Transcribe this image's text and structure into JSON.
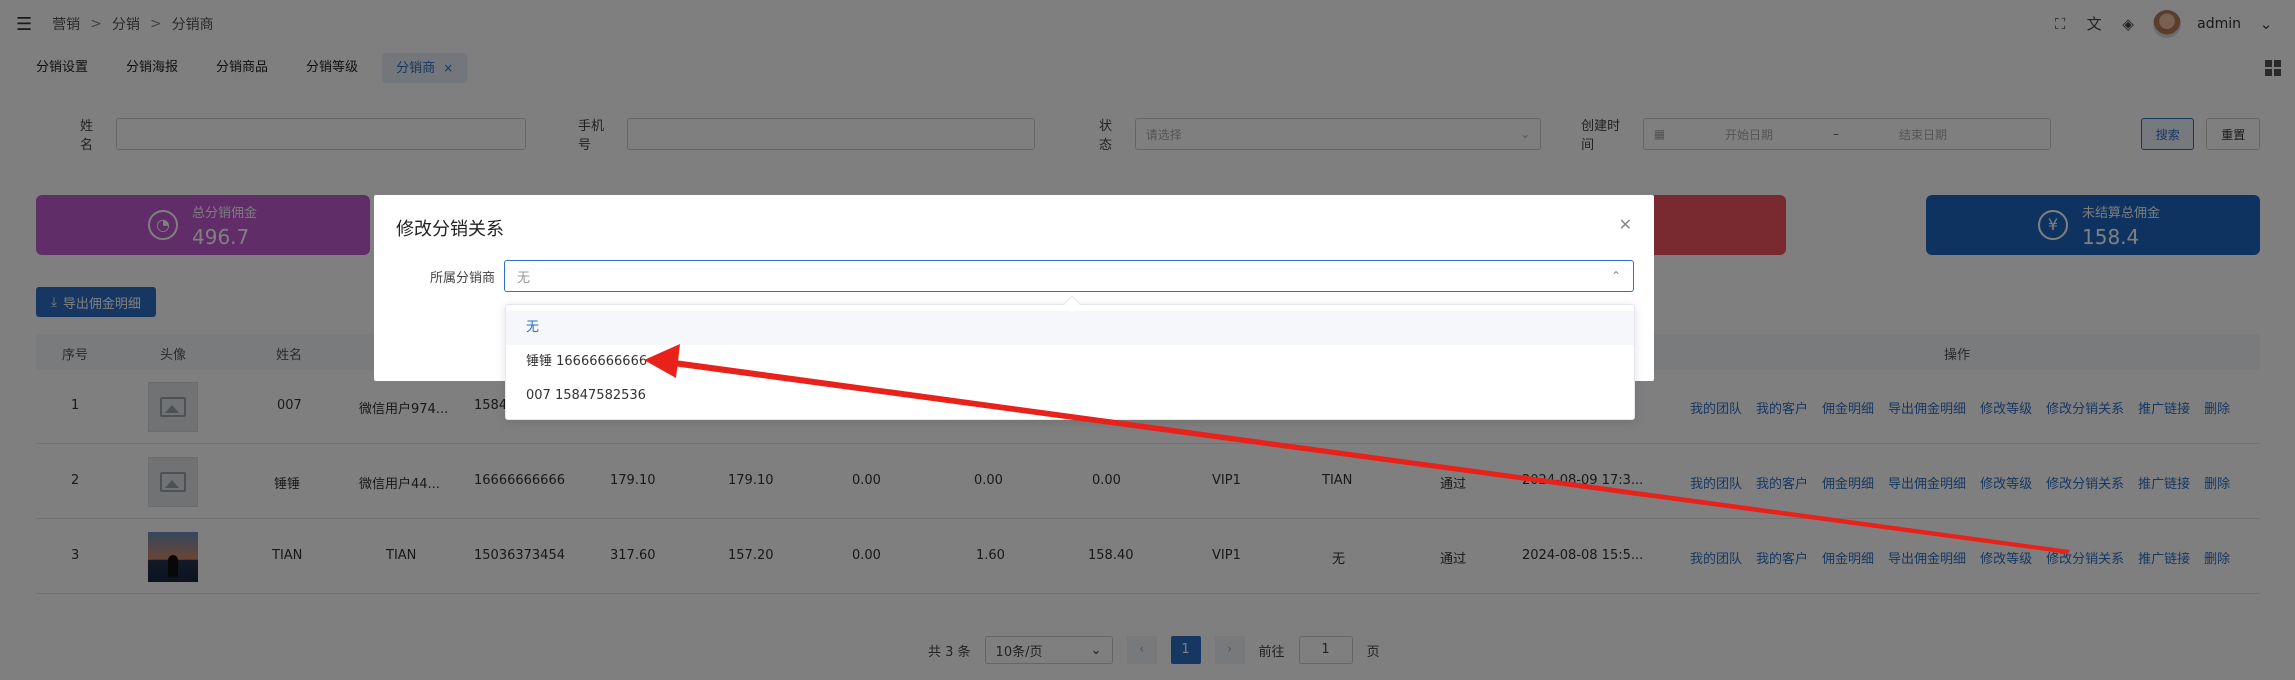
{
  "header": {
    "breadcrumb": [
      "营销",
      "分销",
      "分销商"
    ],
    "breadcrumb_sep": ">",
    "admin": "admin"
  },
  "tags": [
    "分销设置",
    "分销海报",
    "分销商品",
    "分销等级",
    "分销商"
  ],
  "search": {
    "name_label": "姓名",
    "phone_label": "手机号",
    "status_label": "状态",
    "status_placeholder": "请选择",
    "created_label": "创建时间",
    "start_placeholder": "开始日期",
    "range_sep": "–",
    "end_placeholder": "结束日期",
    "search_btn": "搜索",
    "reset_btn": "重置"
  },
  "cards": {
    "first": {
      "label": "总分销佣金",
      "value": "496.7",
      "color": "#8e2a99"
    },
    "last": {
      "label": "未结算总佣金",
      "value": "158.4",
      "color": "#0f3a6f"
    }
  },
  "export_btn": "导出佣金明细",
  "table": {
    "headers": {
      "index": "序号",
      "avatar": "头像",
      "name": "姓名",
      "ops": "操作"
    },
    "rows": [
      {
        "index": "1",
        "name": "007",
        "nickname": "微信用户974...",
        "phone": "1584",
        "c1": "",
        "c2": "",
        "c3": "",
        "c4": "",
        "c5": "",
        "level": "",
        "parent": "",
        "status": "",
        "time": ""
      },
      {
        "index": "2",
        "name": "锤锤",
        "nickname": "微信用户44...",
        "phone": "16666666666",
        "c1": "179.10",
        "c2": "179.10",
        "c3": "0.00",
        "c4": "0.00",
        "c5": "0.00",
        "level": "VIP1",
        "parent": "TIAN",
        "status": "通过",
        "time": "2024-08-09 17:3..."
      },
      {
        "index": "3",
        "name": "TIAN",
        "nickname": "TIAN",
        "phone": "15036373454",
        "c1": "317.60",
        "c2": "157.20",
        "c3": "0.00",
        "c4": "1.60",
        "c5": "158.40",
        "level": "VIP1",
        "parent": "无",
        "status": "通过",
        "time": "2024-08-08 15:5..."
      }
    ],
    "actions": [
      "我的团队",
      "我的客户",
      "佣金明细",
      "导出佣金明细",
      "修改等级",
      "修改分销关系",
      "推广链接",
      "删除"
    ]
  },
  "pager": {
    "total": "共 3 条",
    "page_size": "10条/页",
    "prev": "‹",
    "current": "1",
    "next": "›",
    "goto": "前往",
    "goto_value": "1",
    "page_unit": "页"
  },
  "dialog": {
    "title": "修改分销关系",
    "field_label": "所属分销商",
    "select_value": "无",
    "options": [
      "无",
      "锤锤 16666666666",
      "007 15847582536"
    ],
    "selected_index": 0
  },
  "icons": {
    "menu": "hamburger-icon",
    "fullscreen": "fullscreen-icon",
    "translate": "translate-icon",
    "skin": "skin-icon",
    "close": "close-icon",
    "chevron": "chevron-up-icon"
  }
}
